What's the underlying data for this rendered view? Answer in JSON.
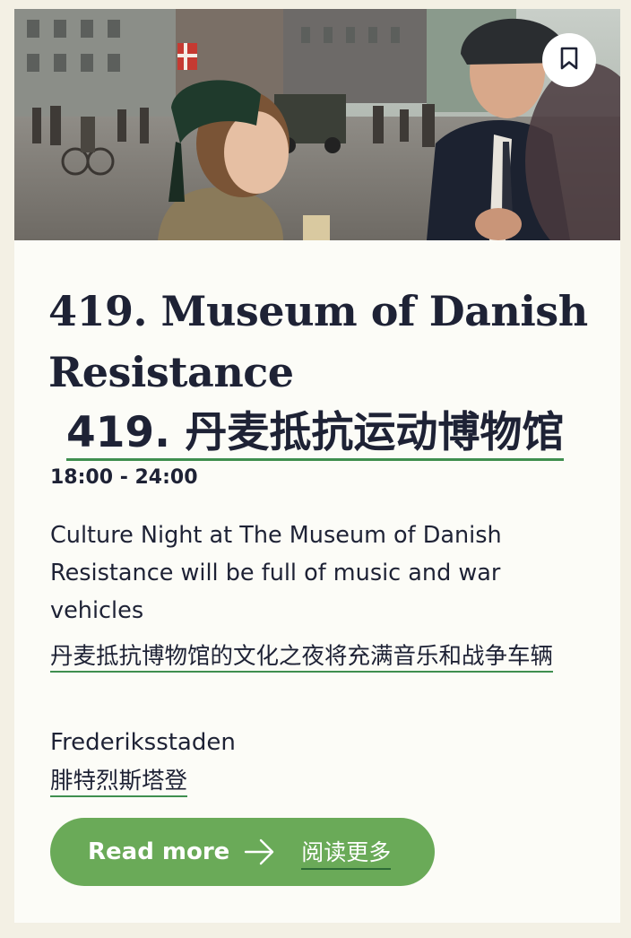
{
  "card": {
    "bookmark_icon": "bookmark-icon",
    "title": "419. Museum of Danish Resistance",
    "title_translation": "419. 丹麦抵抗运动博物馆",
    "time": "18:00 - 24:00",
    "description": "Culture Night at The Museum of Danish Resistance will be full of music and war vehicles",
    "description_translation": "丹麦抵抗博物馆的文化之夜将充满音乐和战争车辆",
    "location": "Frederiksstaden",
    "location_translation": "腓特烈斯塔登",
    "read_more_label": "Read more",
    "read_more_icon": "arrow-right-icon",
    "read_more_translation": "阅读更多"
  },
  "colors": {
    "page_background": "#f3f0e4",
    "card_background": "#fcfcf7",
    "text": "#1e2235",
    "accent_green": "#6aaa58",
    "underline_green": "#3f8f4f"
  }
}
